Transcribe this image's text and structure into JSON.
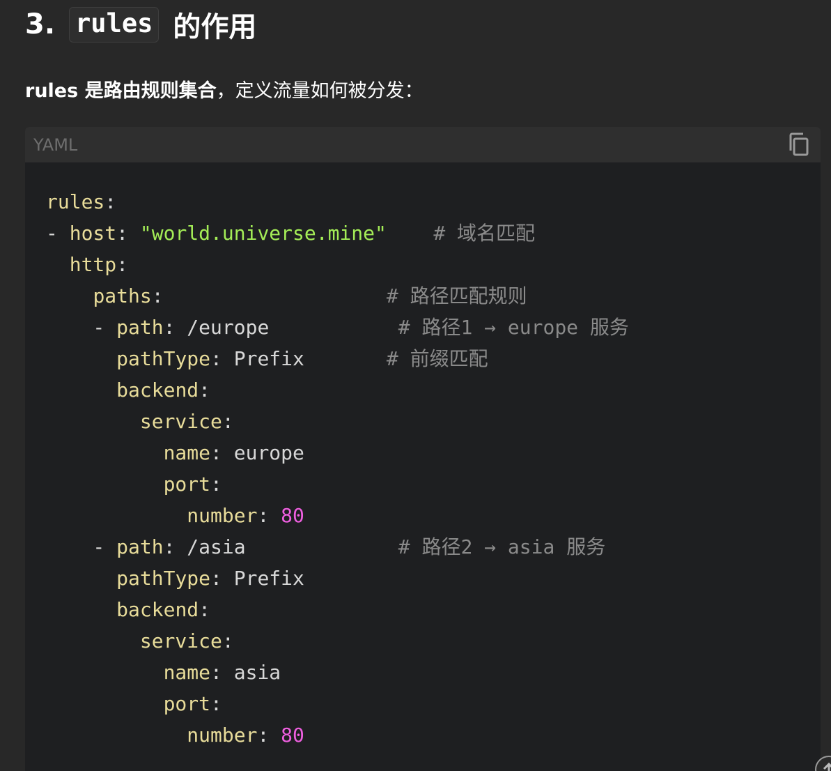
{
  "heading": {
    "number": "3.",
    "code": "rules",
    "suffix": "的作用"
  },
  "intro": {
    "bold": "rules 是路由规则集合",
    "rest": "，定义流量如何被分发："
  },
  "code_block": {
    "language": "YAML",
    "copy_icon": "copy-icon",
    "lines": [
      [
        {
          "t": "rules",
          "c": "k"
        },
        {
          "t": ":",
          "c": "p"
        }
      ],
      [
        {
          "t": "- ",
          "c": "p"
        },
        {
          "t": "host",
          "c": "k"
        },
        {
          "t": ": ",
          "c": "p"
        },
        {
          "t": "\"world.universe.mine\"",
          "c": "s"
        },
        {
          "t": "    # 域名匹配",
          "c": "c"
        }
      ],
      [
        {
          "t": "  ",
          "c": "p"
        },
        {
          "t": "http",
          "c": "k"
        },
        {
          "t": ":",
          "c": "p"
        }
      ],
      [
        {
          "t": "    ",
          "c": "p"
        },
        {
          "t": "paths",
          "c": "k"
        },
        {
          "t": ":",
          "c": "p"
        },
        {
          "t": "                   # 路径匹配规则",
          "c": "c"
        }
      ],
      [
        {
          "t": "    - ",
          "c": "p"
        },
        {
          "t": "path",
          "c": "k"
        },
        {
          "t": ": /europe",
          "c": "p"
        },
        {
          "t": "           # 路径1 → europe 服务",
          "c": "c"
        }
      ],
      [
        {
          "t": "      ",
          "c": "p"
        },
        {
          "t": "pathType",
          "c": "k"
        },
        {
          "t": ": Prefix",
          "c": "p"
        },
        {
          "t": "       # 前缀匹配",
          "c": "c"
        }
      ],
      [
        {
          "t": "      ",
          "c": "p"
        },
        {
          "t": "backend",
          "c": "k"
        },
        {
          "t": ":",
          "c": "p"
        }
      ],
      [
        {
          "t": "        ",
          "c": "p"
        },
        {
          "t": "service",
          "c": "k"
        },
        {
          "t": ":",
          "c": "p"
        }
      ],
      [
        {
          "t": "          ",
          "c": "p"
        },
        {
          "t": "name",
          "c": "k"
        },
        {
          "t": ": europe",
          "c": "p"
        }
      ],
      [
        {
          "t": "          ",
          "c": "p"
        },
        {
          "t": "port",
          "c": "k"
        },
        {
          "t": ":",
          "c": "p"
        }
      ],
      [
        {
          "t": "            ",
          "c": "p"
        },
        {
          "t": "number",
          "c": "k"
        },
        {
          "t": ": ",
          "c": "p"
        },
        {
          "t": "80",
          "c": "n"
        }
      ],
      [
        {
          "t": "    - ",
          "c": "p"
        },
        {
          "t": "path",
          "c": "k"
        },
        {
          "t": ": /asia",
          "c": "p"
        },
        {
          "t": "             # 路径2 → asia 服务",
          "c": "c"
        }
      ],
      [
        {
          "t": "      ",
          "c": "p"
        },
        {
          "t": "pathType",
          "c": "k"
        },
        {
          "t": ": Prefix",
          "c": "p"
        }
      ],
      [
        {
          "t": "      ",
          "c": "p"
        },
        {
          "t": "backend",
          "c": "k"
        },
        {
          "t": ":",
          "c": "p"
        }
      ],
      [
        {
          "t": "        ",
          "c": "p"
        },
        {
          "t": "service",
          "c": "k"
        },
        {
          "t": ":",
          "c": "p"
        }
      ],
      [
        {
          "t": "          ",
          "c": "p"
        },
        {
          "t": "name",
          "c": "k"
        },
        {
          "t": ": asia",
          "c": "p"
        }
      ],
      [
        {
          "t": "          ",
          "c": "p"
        },
        {
          "t": "port",
          "c": "k"
        },
        {
          "t": ":",
          "c": "p"
        }
      ],
      [
        {
          "t": "            ",
          "c": "p"
        },
        {
          "t": "number",
          "c": "k"
        },
        {
          "t": ": ",
          "c": "p"
        },
        {
          "t": "80",
          "c": "n"
        }
      ]
    ]
  },
  "scroll_top_icon": "arrow-up-icon",
  "colors": {
    "background": "#282828",
    "code_background": "#1e1f21",
    "key": "#e8dc9a",
    "string": "#a4ed57",
    "number": "#ef5fe0",
    "comment": "#8a8a8a"
  }
}
